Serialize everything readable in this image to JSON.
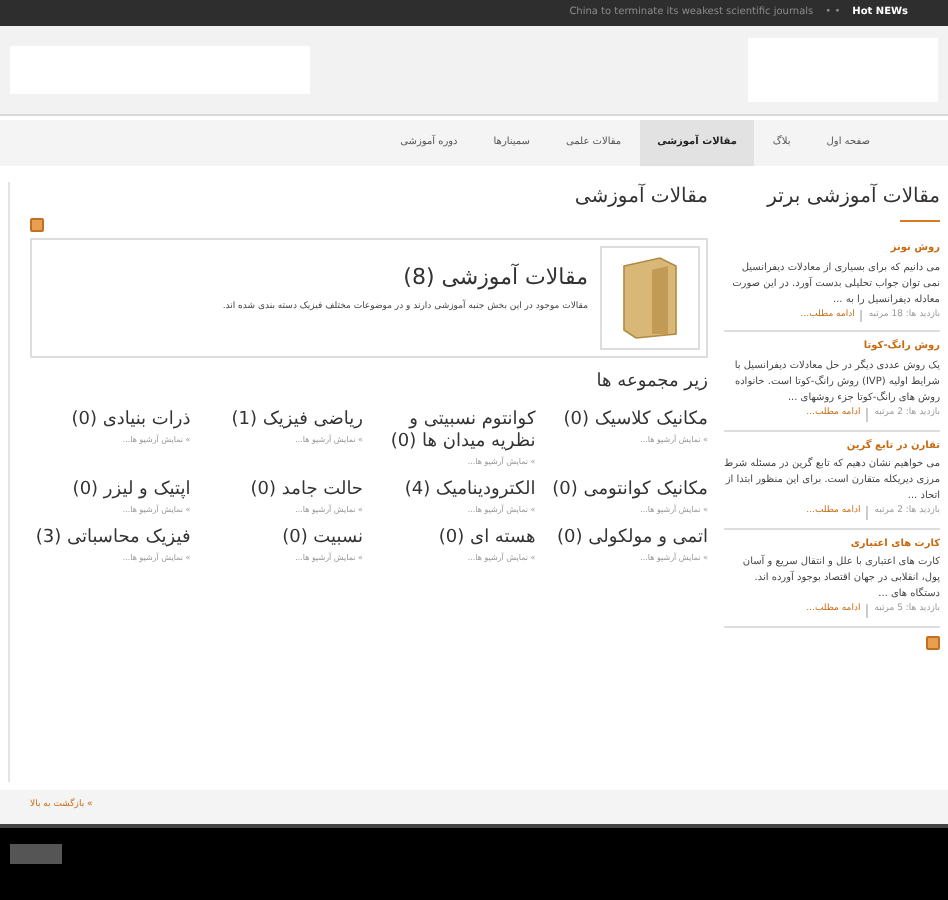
{
  "top_bar": {
    "headline": "China to terminate its weakest scientific journals",
    "dots": "• •",
    "label": "Hot NEWs"
  },
  "nav": [
    {
      "label": "صفحه اول",
      "selected": false
    },
    {
      "label": "بلاگ",
      "selected": false
    },
    {
      "label": "مقالات آموزشی",
      "selected": true
    },
    {
      "label": "مقالات علمی",
      "selected": false
    },
    {
      "label": "سمینارها",
      "selected": false
    },
    {
      "label": "دوره آموزشی",
      "selected": false
    }
  ],
  "main": {
    "title": "مقالات آموزشی",
    "category": {
      "title": "مقالات آموزشی (8)",
      "description": "مقالات موجود در این بخش جنبه آموزشی دارند و در موضوعات مختلف فیزیک دسته بندی شده اند."
    },
    "subcategories_title": "زیر مجموعه ها",
    "subcategories": [
      {
        "name": "مکانیک کلاسیک (0)",
        "link": "» نمایش آرشیو ها..."
      },
      {
        "name": "کوانتوم نسبیتی و نظریه میدان ها (0)",
        "link": "» نمایش آرشیو ها..."
      },
      {
        "name": "ریاضی فیزیک (1)",
        "link": "» نمایش آرشیو ها..."
      },
      {
        "name": "ذرات بنیادی (0)",
        "link": "» نمایش آرشیو ها..."
      },
      {
        "name": "مکانیک کوانتومی (0)",
        "link": "» نمایش آرشیو ها..."
      },
      {
        "name": "الکترودینامیک (4)",
        "link": "» نمایش آرشیو ها..."
      },
      {
        "name": "حالت جامد (0)",
        "link": "» نمایش آرشیو ها..."
      },
      {
        "name": "اپتیک و لیزر (0)",
        "link": "» نمایش آرشیو ها..."
      },
      {
        "name": "اتمی و مولکولی (0)",
        "link": "» نمایش آرشیو ها..."
      },
      {
        "name": "هسته ای (0)",
        "link": "» نمایش آرشیو ها..."
      },
      {
        "name": "نسبیت (0)",
        "link": "» نمایش آرشیو ها..."
      },
      {
        "name": "فیزیک محاسباتی (3)",
        "link": "» نمایش آرشیو ها..."
      }
    ]
  },
  "sidebar": {
    "title": "مقالات آموزشی برتر",
    "articles": [
      {
        "title": "روش نونز",
        "summary": "می دانیم که برای بسیاری از معادلات دیفرانسیل نمی توان جواب تحلیلی بدست آورد. در این صورت معادله دیفرانسیل را به ...",
        "hits": "بازدید ها: 18 مرتبه",
        "more": "ادامه مطلب..."
      },
      {
        "title": "روش رانگ-کوتا",
        "summary": "یک روش عددی دیگر در حل معادلات دیفرانسیل با شرایط اولیه (IVP) روش رانگ-کوتا است. خانواده روش های رانگ-کوتا جزء روشهای ...",
        "hits": "بازدید ها: 2 مرتبه",
        "more": "ادامه مطلب..."
      },
      {
        "title": "تقارن در تابع گرین",
        "summary": "می خواهیم نشان دهیم که تابع گرین در مسئله شرط مرزی دیریکله متقارن است. برای این منظور ابتدا از اتحاد ...",
        "hits": "بازدید ها: 2 مرتبه",
        "more": "ادامه مطلب..."
      },
      {
        "title": "کارت های اعتباری",
        "summary": "کارت های اعتباری با علل و انتقال سریع و آسان پول، انقلابی در جهان اقتصاد بوجود آورده اند. دستگاه های ...",
        "hits": "بازدید ها: 5 مرتبه",
        "more": "ادامه مطلب..."
      }
    ]
  },
  "footer": {
    "back_to_top": "» بازگشت به بالا"
  }
}
